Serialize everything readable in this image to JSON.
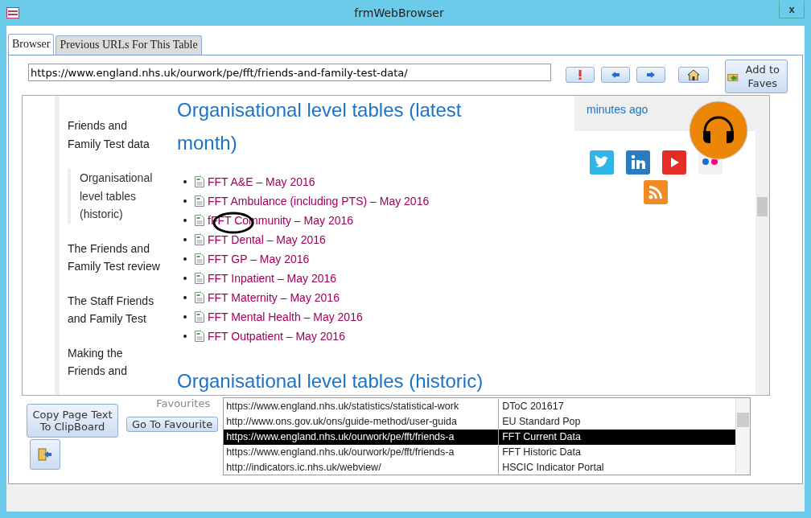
{
  "window": {
    "title": "frmWebBrowser",
    "close": "x"
  },
  "tabs": [
    {
      "label": "Browser",
      "selected": true
    },
    {
      "label": "Previous URLs For This Table",
      "selected": false
    }
  ],
  "address": {
    "value": "https://www.england.nhs.uk/ourwork/pe/fft/friends-and-family-test-data/"
  },
  "toolbar": {
    "add_to_faves": "Add to Faves"
  },
  "page": {
    "nav": [
      {
        "label": "Friends and Family Test data",
        "selected": false
      },
      {
        "label": "Organisational level tables (historic)",
        "selected": true
      },
      {
        "label": "The Friends and Family Test review",
        "selected": false
      },
      {
        "label": "The Staff Friends and Family Test",
        "selected": false
      },
      {
        "label": "Making the Friends and",
        "selected": false
      }
    ],
    "heading": "Organisational level tables (latest month)",
    "links": [
      "FFT A&E – May 2016",
      "FFT Ambulance (including PTS) – May 2016",
      "fFFT Community – May 2016",
      "FFT Dental – May 2016",
      "FFT GP – May 2016",
      "FFT Inpatient – May 2016",
      "FFT Maternity – May  2016",
      "FFT Mental Health – May 2016",
      "FFT Outpatient – May 2016"
    ],
    "heading_2": "Organisational level tables (historic)",
    "updated": "minutes ago"
  },
  "buttons": {
    "copy": "Copy Page Text To ClipBoard",
    "go": "Go To Favourite"
  },
  "favourites": {
    "label": "Favourites",
    "rows": [
      {
        "url": "https://www.england.nhs.uk/statistics/statistical-work",
        "name": "DToC 201617",
        "selected": false
      },
      {
        "url": "http://www.ons.gov.uk/ons/guide-method/user-guida",
        "name": "EU Standard Pop",
        "selected": false
      },
      {
        "url": "https://www.england.nhs.uk/ourwork/pe/fft/friends-a",
        "name": "FFT Current Data",
        "selected": true
      },
      {
        "url": "https://www.england.nhs.uk/ourwork/pe/fft/friends-a",
        "name": "FFT Historic Data",
        "selected": false
      },
      {
        "url": "http://indicators.ic.nhs.uk/webview/",
        "name": "HSCIC Indicator Portal",
        "selected": false
      }
    ]
  }
}
